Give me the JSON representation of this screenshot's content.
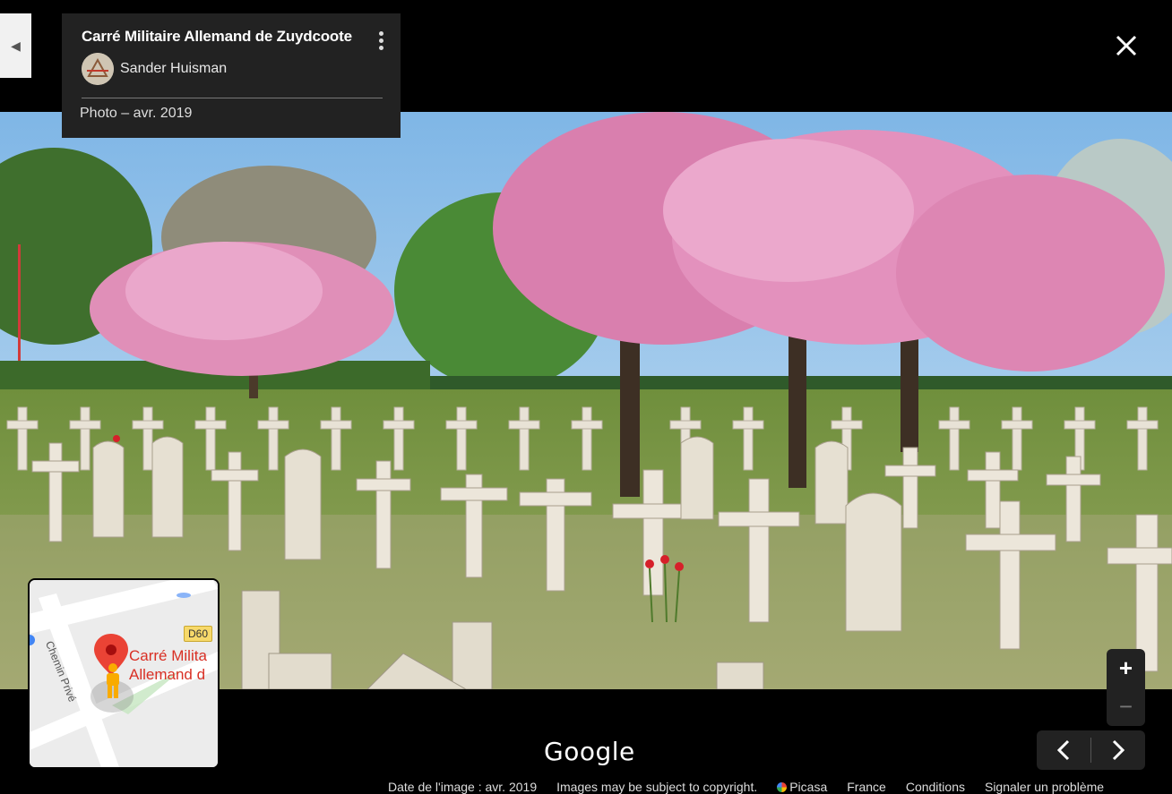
{
  "info_card": {
    "title": "Carré Militaire Allemand de Zuydcoote",
    "author": "Sander Huisman",
    "photo_date": "Photo – avr. 2019"
  },
  "minimap": {
    "place_label_line1": "Carré Milita",
    "place_label_line2": "Allemand d",
    "road_sign": "D60",
    "street_name": "Chemin Privé"
  },
  "zoom": {
    "in_label": "+",
    "out_label": "−"
  },
  "logo": "Google",
  "footer": {
    "image_date": "Date de l'image : avr. 2019",
    "copyright": "Images may be subject to copyright.",
    "provider": "Picasa",
    "country": "France",
    "terms": "Conditions",
    "report": "Signaler un problème"
  },
  "icons": {
    "collapse": "chevron-left-icon",
    "more": "more-vert-icon",
    "close": "close-icon",
    "prev": "chevron-left-icon",
    "next": "chevron-right-icon",
    "pin": "map-pin-icon",
    "pegman": "pegman-icon"
  },
  "colors": {
    "background": "#000000",
    "card": "#222222",
    "map_pin": "#d93025",
    "pegman": "#f9ab00"
  }
}
